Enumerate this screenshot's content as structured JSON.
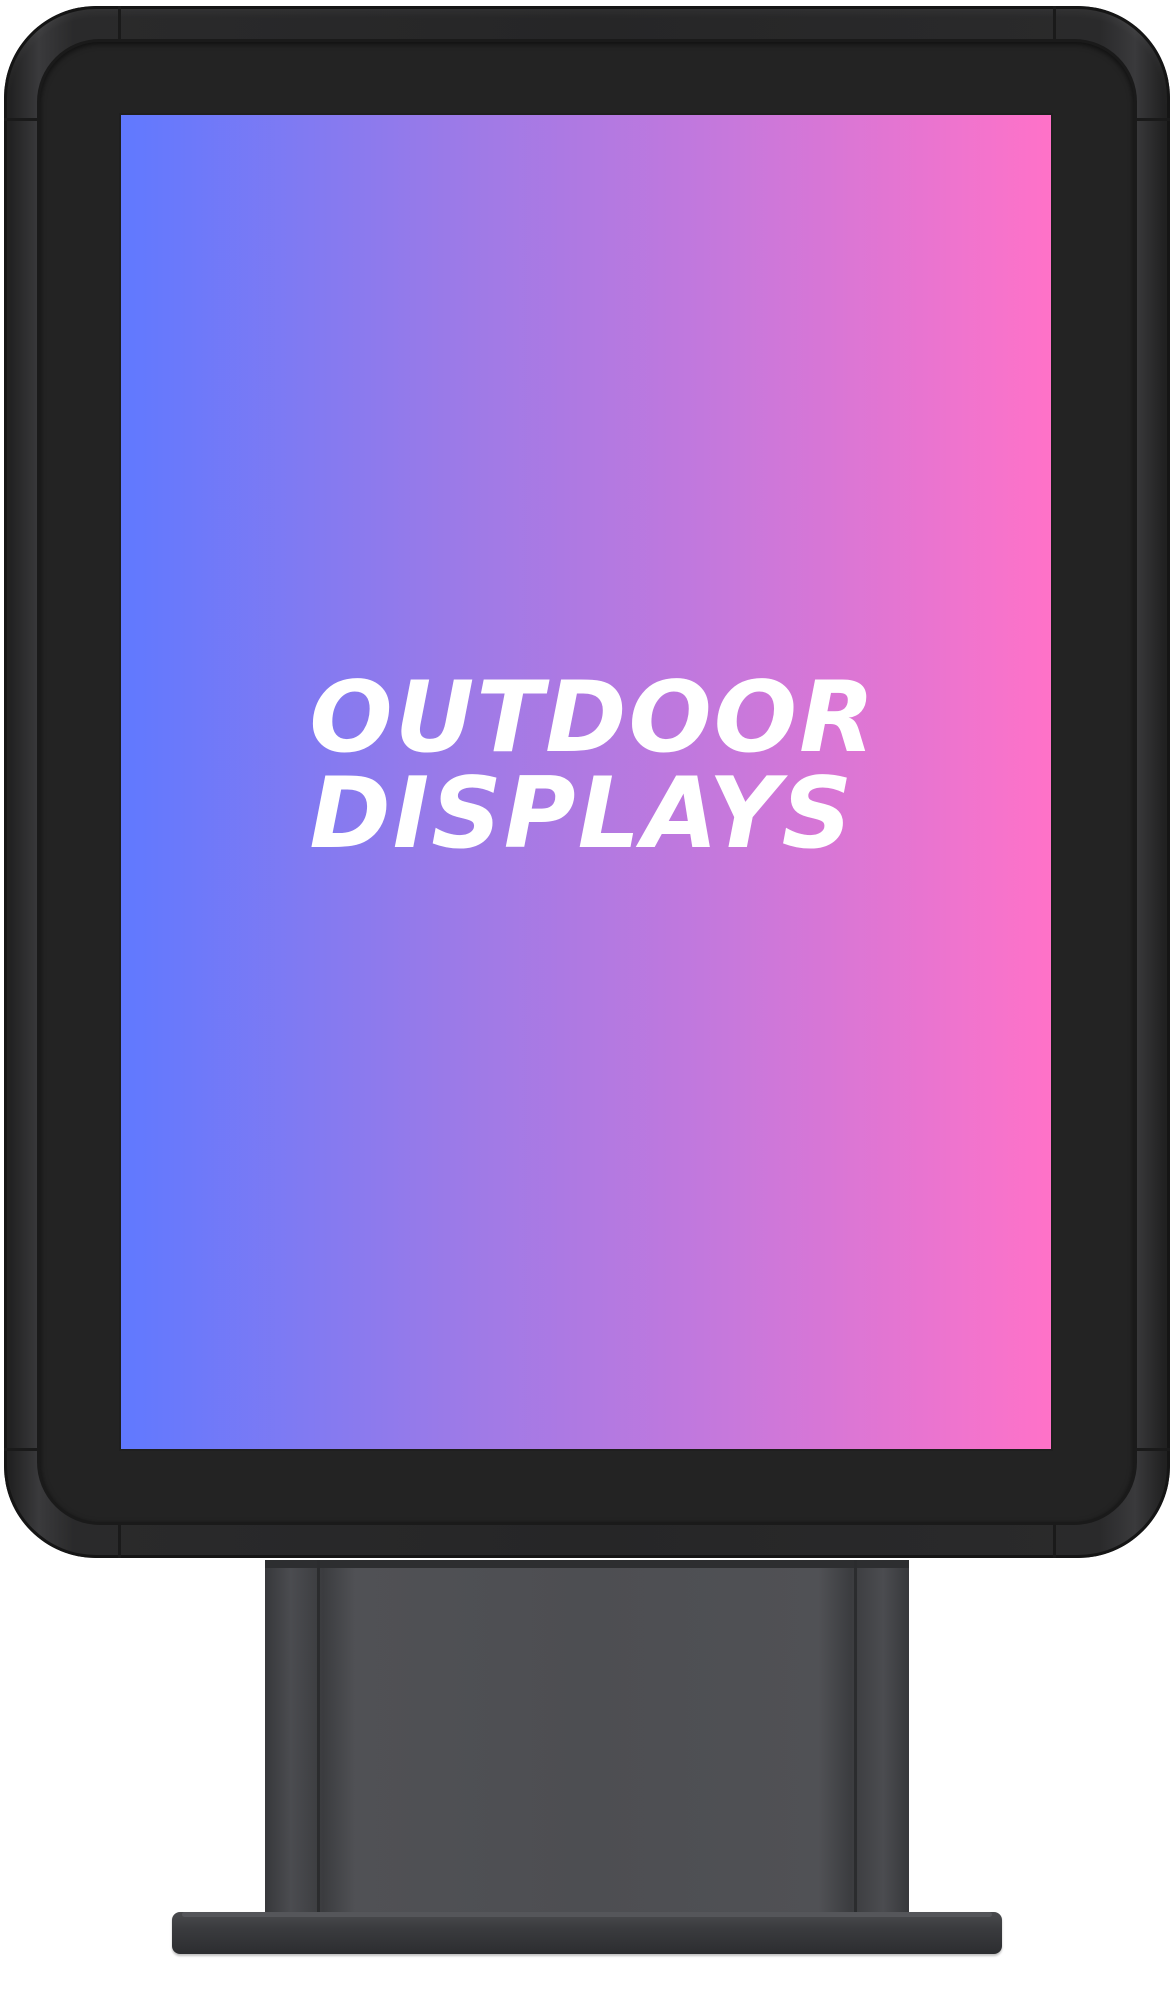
{
  "display": {
    "headline_line1": "OUTDOOR",
    "headline_line2": "DISPLAYS"
  },
  "colors": {
    "gradient_start": "#6079ff",
    "gradient_end": "#ff72c8",
    "frame": "#262627",
    "stand": "#4d4e52",
    "text": "#ffffff"
  }
}
